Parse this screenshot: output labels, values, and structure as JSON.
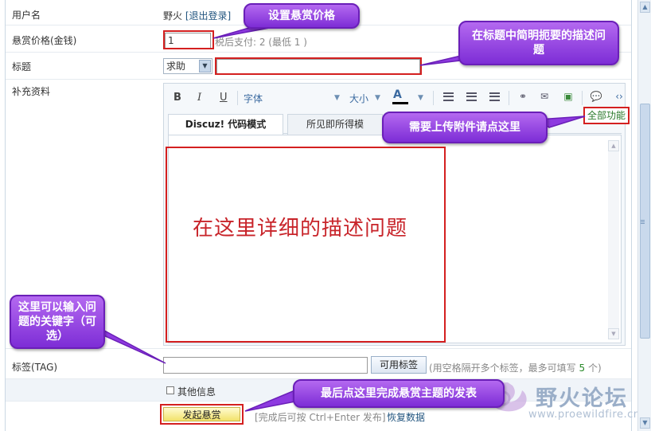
{
  "form": {
    "username_label": "用户名",
    "username_value": "野火",
    "logout_link": "[退出登录]",
    "price_label": "悬赏价格(金钱)",
    "price_value": "1",
    "price_hint": "税后支付: 2 (最低  1 )",
    "title_label": "标题",
    "category_selected": "求助",
    "supplement_label": "补充资料",
    "tag_label": "标签(TAG)",
    "tag_button": "可用标签",
    "tag_hint_prefix": "(用空格隔开多个标签，最多可填写",
    "tag_hint_count": "5",
    "tag_hint_suffix": "个)",
    "other_info": "其他信息",
    "submit_button": "发起悬赏",
    "submit_hint": "[完成后可按 Ctrl+Enter 发布]",
    "restore_link": "恢复数据"
  },
  "editor": {
    "toolbar": {
      "bold": "B",
      "italic": "I",
      "underline": "U",
      "font": "字体",
      "size": "大小",
      "color": "A"
    },
    "tabs": [
      "Discuz! 代码模式",
      "所见即所得模式"
    ],
    "all_features": "全部功能"
  },
  "annotations": {
    "set_price": "设置悬赏价格",
    "title_desc": "在标题中简明扼要的描述问题",
    "upload_hint": "需要上传附件请点这里",
    "detail_desc": "在这里详细的描述问题",
    "keywords": "这里可以输入问题的关键字（可选）",
    "final_submit": "最后点这里完成悬赏主题的发表"
  },
  "watermark": {
    "title": "野火论坛",
    "url": "www.proewildfire.cn"
  },
  "colors": {
    "callout_purple": "#8e3ae0",
    "annotation_red": "#d42020",
    "link_blue": "#22557f"
  }
}
